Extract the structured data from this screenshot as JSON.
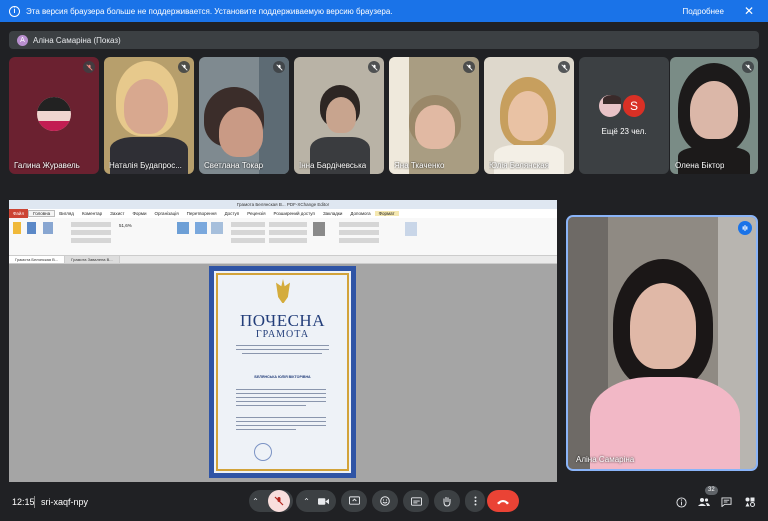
{
  "banner": {
    "message": "Эта версия браузера больше не поддерживается. Установите поддерживаемую версию браузера.",
    "more_label": "Подробнее",
    "close_glyph": "✕"
  },
  "presenter": {
    "avatar_letter": "A",
    "label": "Аліна Самаріна (Показ)"
  },
  "participants": [
    {
      "name": "Галина Журавель",
      "muted": true
    },
    {
      "name": "Наталія Будапрос...",
      "muted": true
    },
    {
      "name": "Светлана Токар",
      "muted": true
    },
    {
      "name": "Інна Бардічевська",
      "muted": true
    },
    {
      "name": "Яна Ткаченко",
      "muted": true
    },
    {
      "name": "Юлія Белянская",
      "muted": true
    },
    {
      "name": "Ещё 23 чел.",
      "avatar_letter": "S"
    },
    {
      "name": "Олена Біктор",
      "muted": true
    }
  ],
  "share": {
    "window_title": "Грамота Бeлянская В... PDF-XChange Editor",
    "menu": [
      "Файл",
      "Головна",
      "Вигляд",
      "Коментар",
      "Захист",
      "Форми",
      "Організація",
      "Перетворення",
      "Доступ",
      "Рецензія",
      "Розширений доступ",
      "Закладки",
      "Допомога",
      "Формат"
    ],
    "tabs": [
      "Грамота Белянская В...",
      "Грамота Завалена В..."
    ],
    "zoom": "51,6%",
    "certificate_title": "ПОЧЕСНА",
    "certificate_subtitle": "ГРАМОТА",
    "awardee": "БЕЛЯНСЬКА ЮЛІЯ ВІКТОРІВНА"
  },
  "self_view": {
    "name": "Аліна Самаріна"
  },
  "bottombar": {
    "time": "12:15",
    "meeting_code": "sri-xaqf-npy",
    "participant_count": "32"
  },
  "colors": {
    "accent": "#1a73e8",
    "muted_red": "#f9dedc",
    "end_call": "#ea4335",
    "background": "#202124"
  }
}
